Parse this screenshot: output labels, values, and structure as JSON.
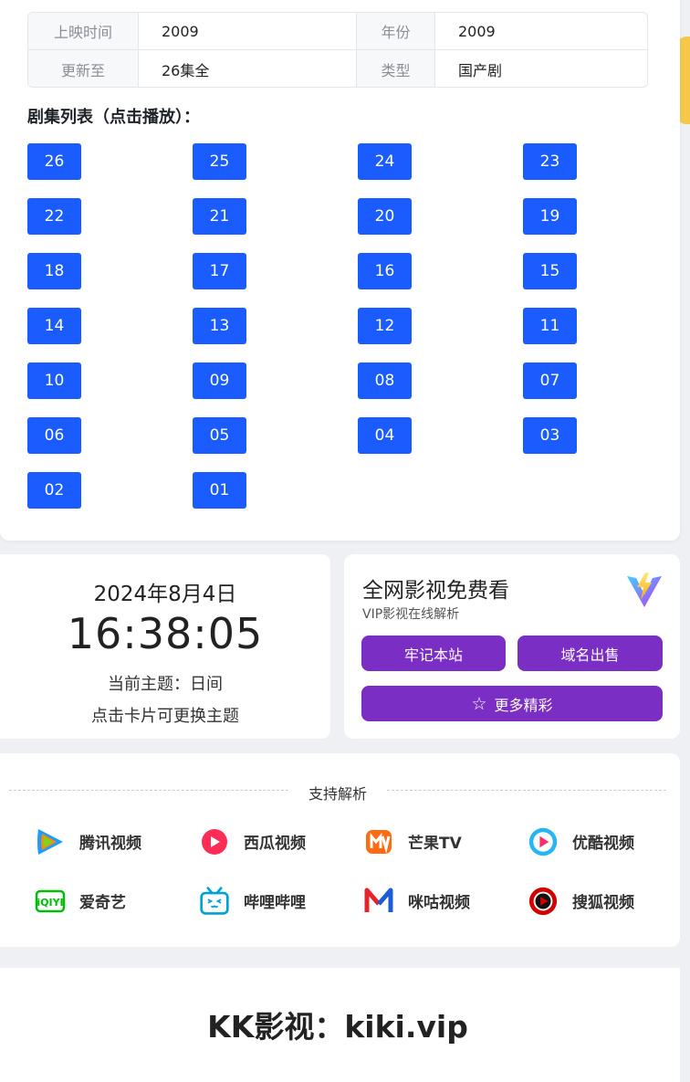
{
  "info": {
    "release_label": "上映时间",
    "release_value": "2009",
    "year_label": "年份",
    "year_value": "2009",
    "update_label": "更新至",
    "update_value": "26集全",
    "type_label": "类型",
    "type_value": "国产剧"
  },
  "episodes": {
    "title": "剧集列表（点击播放）：",
    "items": [
      "26",
      "25",
      "24",
      "23",
      "22",
      "21",
      "20",
      "19",
      "18",
      "17",
      "16",
      "15",
      "14",
      "13",
      "12",
      "11",
      "10",
      "09",
      "08",
      "07",
      "06",
      "05",
      "04",
      "03",
      "02",
      "01"
    ]
  },
  "clock": {
    "date": "2024年8月4日",
    "time": "16:38:05",
    "theme": "当前主题：日间",
    "hint": "点击卡片可更换主题"
  },
  "vip": {
    "title": "全网影视免费看",
    "subtitle": "VIP影视在线解析",
    "bookmark_label": "牢记本站",
    "domain_sale_label": "域名出售",
    "more_label": "更多精彩"
  },
  "support": {
    "title": "支持解析",
    "platforms": [
      {
        "name": "腾讯视频",
        "icon": "tencent-video-icon"
      },
      {
        "name": "西瓜视频",
        "icon": "xigua-video-icon"
      },
      {
        "name": "芒果TV",
        "icon": "mango-tv-icon"
      },
      {
        "name": "优酷视频",
        "icon": "youku-icon"
      },
      {
        "name": "爱奇艺",
        "icon": "iqiyi-icon"
      },
      {
        "name": "哔哩哔哩",
        "icon": "bilibili-icon"
      },
      {
        "name": "咪咕视频",
        "icon": "migu-video-icon"
      },
      {
        "name": "搜狐视频",
        "icon": "sohu-video-icon"
      }
    ]
  },
  "footer": {
    "text": "KK影视：kiki.vip"
  },
  "colors": {
    "episode_button": "#1a5cff",
    "vip_button": "#7b2ec4",
    "accent_yellow": "#f6c84a"
  }
}
